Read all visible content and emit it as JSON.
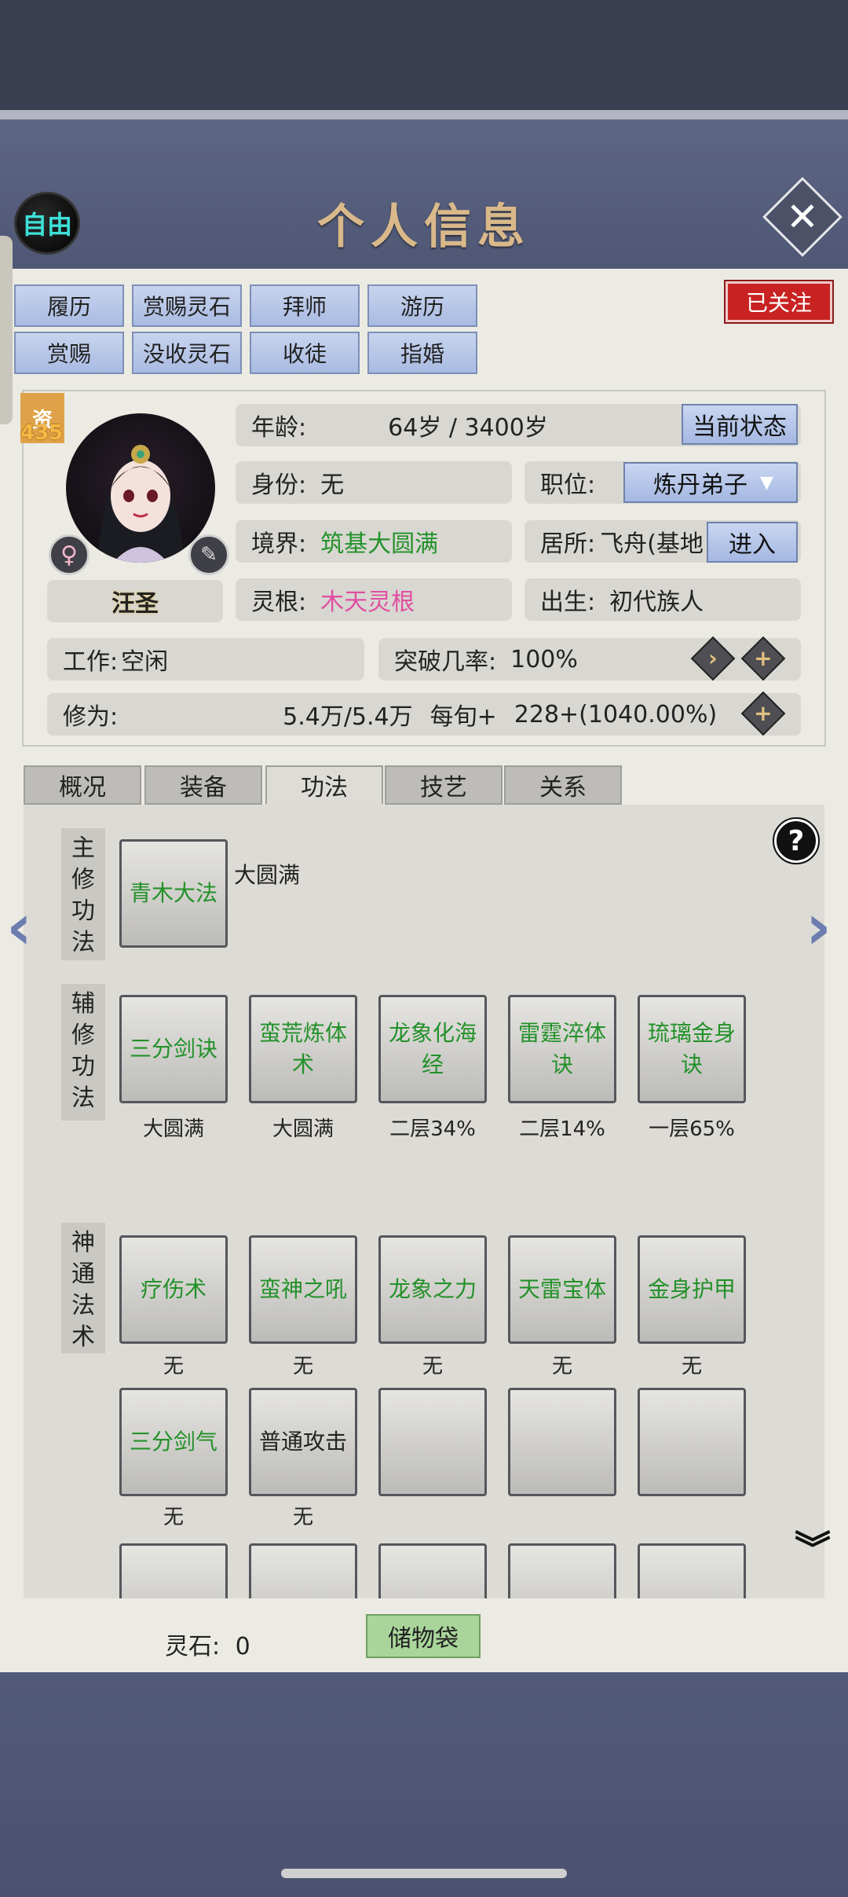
{
  "header": {
    "title": "个人信息",
    "free_label": "自由",
    "close_label": "✕"
  },
  "actions": {
    "row1": [
      "履历",
      "赏赐灵石",
      "拜师",
      "游历"
    ],
    "row2": [
      "赏赐",
      "没收灵石",
      "收徒",
      "指婚"
    ],
    "followed": "已关注"
  },
  "profile": {
    "resource_label": "资",
    "resource_value": "435",
    "name": "汪圣",
    "gender_symbol": "♀",
    "age_label": "年龄:",
    "age_value": "64岁 / 3400岁",
    "status_button": "当前状态",
    "identity_label": "身份:",
    "identity_value": "无",
    "position_label": "职位:",
    "position_value": "炼丹弟子",
    "realm_label": "境界:",
    "realm_value": "筑基大圆满",
    "residence_label": "居所:",
    "residence_value": "飞舟(基地",
    "enter_button": "进入",
    "root_label": "灵根:",
    "root_value": "木天灵根",
    "birth_label": "出生:",
    "birth_value": "初代族人",
    "work_label": "工作:",
    "work_value": "空闲",
    "breakthrough_label": "突破几率:",
    "breakthrough_value": "100%",
    "cultivation_label": "修为:",
    "cultivation_value": "5.4万/5.4万",
    "per_period_label": "每旬+",
    "per_period_value": "228+(1040.00%)"
  },
  "tabs": [
    "概况",
    "装备",
    "功法",
    "技艺",
    "关系"
  ],
  "active_tab": "功法",
  "skills": {
    "main_label": [
      "主",
      "修",
      "功",
      "法"
    ],
    "main": {
      "name": "青木大法",
      "level": "大圆满"
    },
    "aux_label": [
      "辅",
      "修",
      "功",
      "法"
    ],
    "aux": [
      {
        "name": "三分剑诀",
        "level": "大圆满"
      },
      {
        "name": "蛮荒炼体术",
        "level": "大圆满"
      },
      {
        "name": "龙象化海经",
        "level": "二层34%"
      },
      {
        "name": "雷霆淬体诀",
        "level": "二层14%"
      },
      {
        "name": "琉璃金身诀",
        "level": "一层65%"
      }
    ],
    "magic_label": [
      "神",
      "通",
      "法",
      "术"
    ],
    "magic": [
      {
        "name": "疗伤术",
        "level": "无"
      },
      {
        "name": "蛮神之吼",
        "level": "无"
      },
      {
        "name": "龙象之力",
        "level": "无"
      },
      {
        "name": "天雷宝体",
        "level": "无"
      },
      {
        "name": "金身护甲",
        "level": "无"
      },
      {
        "name": "三分剑气",
        "level": "无"
      },
      {
        "name": "普通攻击",
        "level": "无"
      }
    ],
    "help": "?"
  },
  "footer": {
    "stone_label": "灵石:",
    "stone_value": "0",
    "bag_button": "储物袋"
  },
  "colors": {
    "panel": "#ecebe3",
    "header": "#55607e",
    "skill_green": "#23912a",
    "root_pink": "#e04fa0",
    "followed_red": "#c92222"
  }
}
